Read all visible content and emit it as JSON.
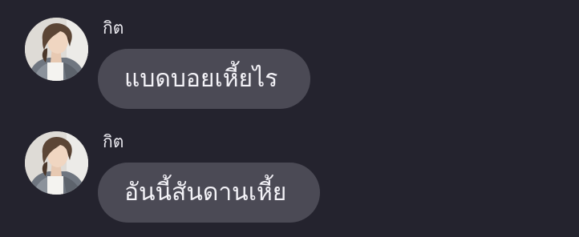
{
  "chat": {
    "messages": [
      {
        "sender": "กิต",
        "avatar_icon": "profile-photo",
        "text": "แบดบอยเหี้ยไร"
      },
      {
        "sender": "กิต",
        "avatar_icon": "profile-photo",
        "text": "อันนี้สันดานเหี้ย"
      }
    ]
  },
  "colors": {
    "background": "#24232e",
    "bubble": "#4b4a55",
    "text": "#f3f2f7"
  }
}
